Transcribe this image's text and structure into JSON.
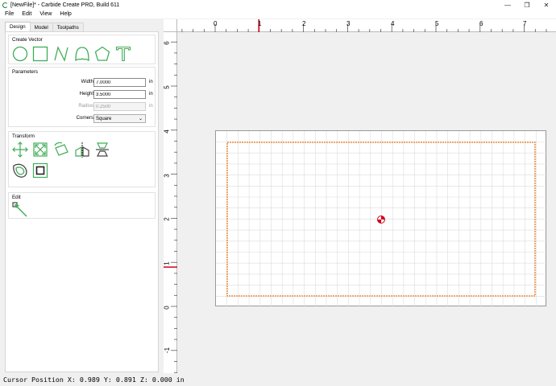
{
  "window": {
    "title": "[NewFile]* - Carbide Create PRO, Build 611",
    "minimize_glyph": "—",
    "maximize_glyph": "❐",
    "close_glyph": "✕"
  },
  "menu": [
    "File",
    "Edit",
    "View",
    "Help"
  ],
  "tabs": [
    "Design",
    "Model",
    "Toolpaths"
  ],
  "groups": {
    "create_vector": "Create Vector",
    "parameters": "Parameters",
    "transform": "Transform",
    "edit": "Edit"
  },
  "parameters": {
    "width_label": "Width",
    "width_value": "7.0000",
    "height_label": "Height",
    "height_value": "3.5000",
    "radius_label": "Radius",
    "radius_value": "0.2500",
    "unit": "in",
    "corners_label": "Corners",
    "corners_value": "Square"
  },
  "icons": {
    "create_vector": [
      "circle-icon",
      "rectangle-icon",
      "polyline-icon",
      "custom-curve-icon",
      "polygon-icon",
      "text-icon"
    ],
    "transform": [
      "move-icon",
      "scale-icon",
      "rotate-icon",
      "mirror-icon",
      "align-icon",
      "offset-icon",
      "boolean-icon"
    ],
    "edit": [
      "node-edit-icon"
    ]
  },
  "colors": {
    "icon_green": "#3fae57",
    "selection_orange": "#e8781e",
    "ruler_marker": "#d0021b"
  },
  "rulers": {
    "x_labels": [
      "0",
      "1",
      "2",
      "3",
      "4",
      "5",
      "6",
      "7"
    ],
    "y_labels": [
      "6",
      "5",
      "4",
      "3",
      "2",
      "1",
      "0",
      "-1"
    ]
  },
  "status": {
    "cursor": "Cursor Position X: 0.989 Y: 0.891 Z: 0.000 in"
  }
}
